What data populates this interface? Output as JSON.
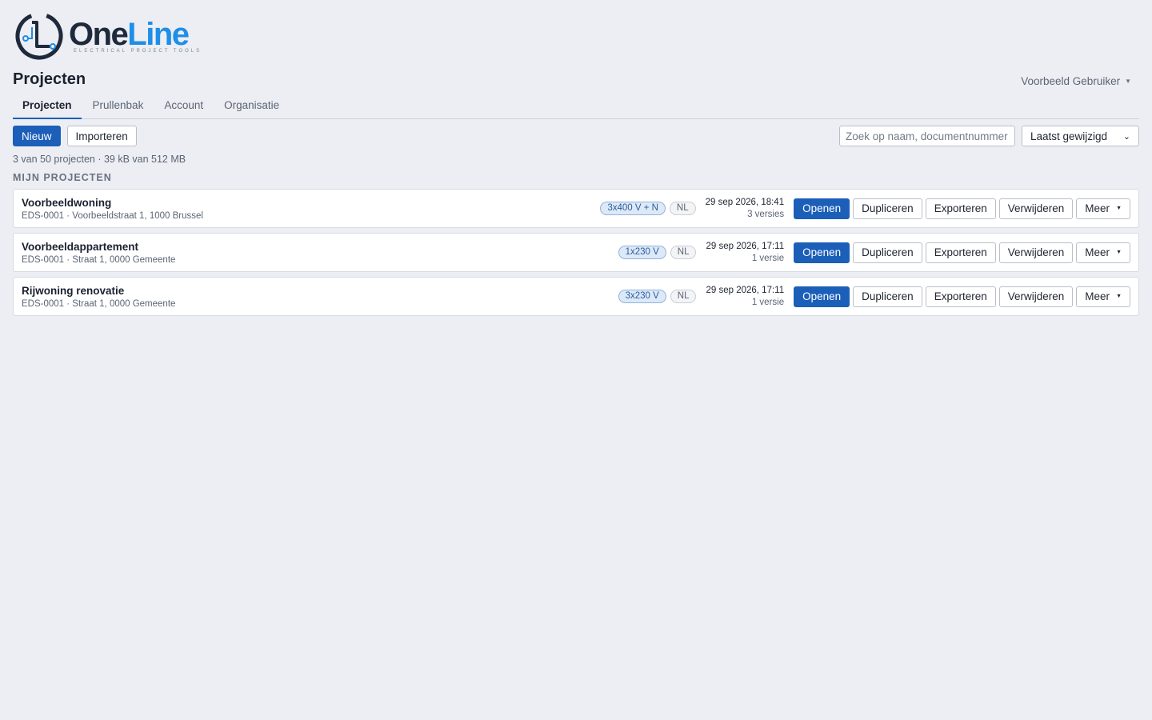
{
  "brand": {
    "word_one": "One",
    "word_line": "Line",
    "tagline": "ELECTRICAL PROJECT TOOLS"
  },
  "page": {
    "title": "Projecten"
  },
  "user": {
    "name": "Voorbeeld Gebruiker"
  },
  "tabs": [
    {
      "label": "Projecten",
      "active": true
    },
    {
      "label": "Prullenbak",
      "active": false
    },
    {
      "label": "Account",
      "active": false
    },
    {
      "label": "Organisatie",
      "active": false
    }
  ],
  "toolbar": {
    "new_label": "Nieuw",
    "import_label": "Importeren",
    "search_placeholder": "Zoek op naam, documentnummer",
    "sort_value": "Laatst gewijzigd"
  },
  "summary": "3 van 50 projecten · 39 kB van 512 MB",
  "section_title": "MIJN PROJECTEN",
  "actions": {
    "open": "Openen",
    "duplicate": "Dupliceren",
    "export": "Exporteren",
    "delete": "Verwijderen",
    "more": "Meer"
  },
  "projects": [
    {
      "name": "Voorbeeldwoning",
      "meta": "EDS-0001 · Voorbeeldstraat 1, 1000 Brussel",
      "voltage": "3x400 V + N",
      "lang": "NL",
      "date": "29 sep 2026, 18:41",
      "versions": "3 versies"
    },
    {
      "name": "Voorbeeldappartement",
      "meta": "EDS-0001 · Straat 1, 0000 Gemeente",
      "voltage": "1x230 V",
      "lang": "NL",
      "date": "29 sep 2026, 17:11",
      "versions": "1 versie"
    },
    {
      "name": "Rijwoning renovatie",
      "meta": "EDS-0001 · Straat 1, 0000 Gemeente",
      "voltage": "3x230 V",
      "lang": "NL",
      "date": "29 sep 2026, 17:11",
      "versions": "1 versie"
    }
  ],
  "colors": {
    "primary": "#1c5fb8",
    "brand_dark": "#1e2a3c",
    "brand_light": "#1f8ee6",
    "background": "#eceef3"
  }
}
